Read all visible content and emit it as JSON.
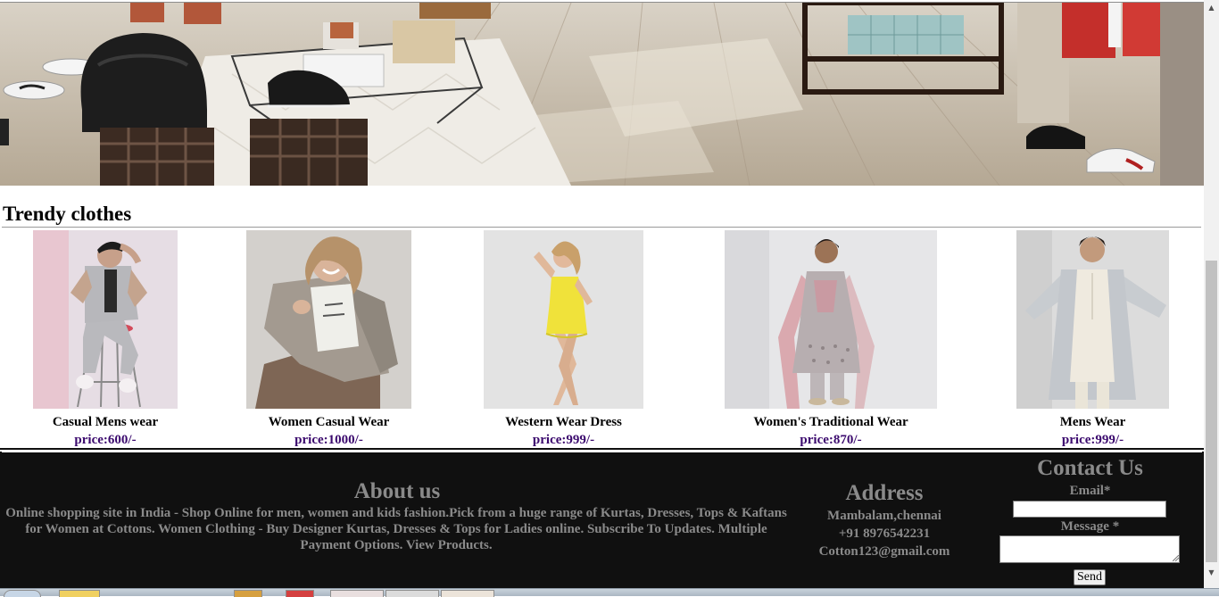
{
  "section": {
    "title": "Trendy clothes"
  },
  "products": [
    {
      "name": "Casual Mens wear",
      "price": "price:600/-"
    },
    {
      "name": "Women Casual Wear",
      "price": "price:1000/-"
    },
    {
      "name": "Western Wear Dress",
      "price": "price:999/-"
    },
    {
      "name": "Women's Traditional Wear",
      "price": "price:870/-"
    },
    {
      "name": "Mens Wear",
      "price": "price:999/-"
    }
  ],
  "footer": {
    "about": {
      "title": "About us",
      "text": "Online shopping site in India - Shop Online for men, women and kids fashion.Pick from a huge range of Kurtas, Dresses, Tops & Kaftans for Women at Cottons. Women Clothing - Buy Designer Kurtas, Dresses & Tops for Ladies online. Subscribe To Updates. Multiple Payment Options. View Products."
    },
    "address": {
      "title": "Address",
      "line1": "Mambalam,chennai",
      "line2": "+91 8976542231",
      "line3": "Cotton123@gmail.com"
    },
    "contact": {
      "title": "Contact Us",
      "email_label": "Email*",
      "email_value": "",
      "message_label": "Message *",
      "message_value": "",
      "send_label": "Send"
    }
  },
  "colors": {
    "footer_bg": "#101010",
    "footer_text": "#8a8a8a",
    "price_text": "#3b0a6e"
  }
}
